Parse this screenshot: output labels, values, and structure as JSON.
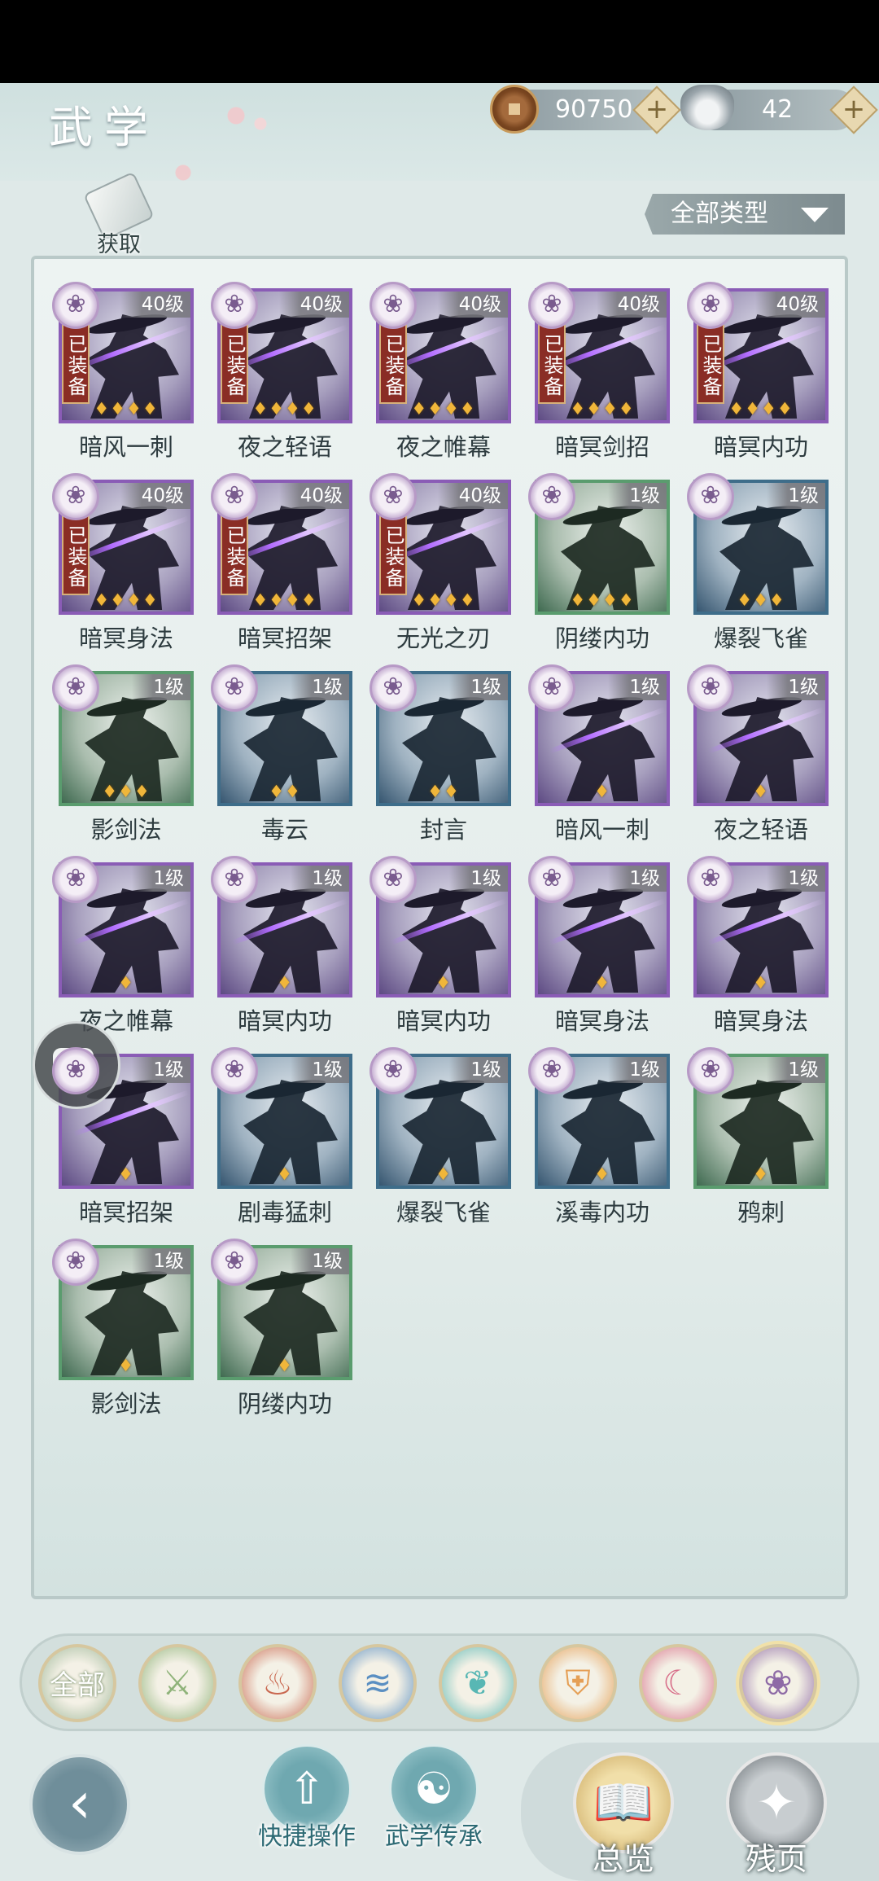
{
  "header": {
    "title": "武学",
    "copper": {
      "value": "90750",
      "icon": "copper-coin-icon"
    },
    "silver": {
      "value": "42",
      "icon": "silver-ingot-icon"
    },
    "plus": "+"
  },
  "acquire_label": "获取",
  "filter": {
    "label": "全部类型"
  },
  "equipped_label": "已装备",
  "skills": [
    {
      "name": "暗风一刺",
      "level": "40级",
      "equipped": true,
      "stars": 4,
      "quality": "purple"
    },
    {
      "name": "夜之轻语",
      "level": "40级",
      "equipped": true,
      "stars": 4,
      "quality": "purple"
    },
    {
      "name": "夜之帷幕",
      "level": "40级",
      "equipped": true,
      "stars": 4,
      "quality": "purple"
    },
    {
      "name": "暗冥剑招",
      "level": "40级",
      "equipped": true,
      "stars": 4,
      "quality": "purple"
    },
    {
      "name": "暗冥内功",
      "level": "40级",
      "equipped": true,
      "stars": 4,
      "quality": "purple"
    },
    {
      "name": "暗冥身法",
      "level": "40级",
      "equipped": true,
      "stars": 4,
      "quality": "purple"
    },
    {
      "name": "暗冥招架",
      "level": "40级",
      "equipped": true,
      "stars": 4,
      "quality": "purple"
    },
    {
      "name": "无光之刃",
      "level": "40级",
      "equipped": true,
      "stars": 4,
      "quality": "purple"
    },
    {
      "name": "阴缕内功",
      "level": "1级",
      "equipped": false,
      "stars": 4,
      "quality": "green"
    },
    {
      "name": "爆裂飞雀",
      "level": "1级",
      "equipped": false,
      "stars": 3,
      "quality": "blue"
    },
    {
      "name": "影剑法",
      "level": "1级",
      "equipped": false,
      "stars": 3,
      "quality": "green"
    },
    {
      "name": "毒云",
      "level": "1级",
      "equipped": false,
      "stars": 2,
      "quality": "blue"
    },
    {
      "name": "封言",
      "level": "1级",
      "equipped": false,
      "stars": 2,
      "quality": "blue"
    },
    {
      "name": "暗风一刺",
      "level": "1级",
      "equipped": false,
      "stars": 1,
      "quality": "purple"
    },
    {
      "name": "夜之轻语",
      "level": "1级",
      "equipped": false,
      "stars": 1,
      "quality": "purple"
    },
    {
      "name": "夜之帷幕",
      "level": "1级",
      "equipped": false,
      "stars": 1,
      "quality": "purple"
    },
    {
      "name": "暗冥内功",
      "level": "1级",
      "equipped": false,
      "stars": 1,
      "quality": "purple"
    },
    {
      "name": "暗冥内功",
      "level": "1级",
      "equipped": false,
      "stars": 1,
      "quality": "purple"
    },
    {
      "name": "暗冥身法",
      "level": "1级",
      "equipped": false,
      "stars": 1,
      "quality": "purple"
    },
    {
      "name": "暗冥身法",
      "level": "1级",
      "equipped": false,
      "stars": 1,
      "quality": "purple"
    },
    {
      "name": "暗冥招架",
      "level": "1级",
      "equipped": false,
      "stars": 1,
      "quality": "purple"
    },
    {
      "name": "剧毒猛刺",
      "level": "1级",
      "equipped": false,
      "stars": 1,
      "quality": "blue"
    },
    {
      "name": "爆裂飞雀",
      "level": "1级",
      "equipped": false,
      "stars": 1,
      "quality": "blue"
    },
    {
      "name": "溪毒内功",
      "level": "1级",
      "equipped": false,
      "stars": 1,
      "quality": "blue"
    },
    {
      "name": "鸦刺",
      "level": "1级",
      "equipped": false,
      "stars": 1,
      "quality": "green"
    },
    {
      "name": "影剑法",
      "level": "1级",
      "equipped": false,
      "stars": 1,
      "quality": "green"
    },
    {
      "name": "阴缕内功",
      "level": "1级",
      "equipped": false,
      "stars": 1,
      "quality": "green"
    }
  ],
  "school_tabs": [
    {
      "id": "all",
      "label": "全部",
      "icon": "all-schools-icon",
      "color": "#9fb89a",
      "selected": false
    },
    {
      "id": "sword",
      "label": "",
      "icon": "sword-school-icon",
      "color": "#8fb37a",
      "selected": false
    },
    {
      "id": "fire",
      "label": "",
      "icon": "flame-school-icon",
      "color": "#c9674f",
      "selected": false
    },
    {
      "id": "wave",
      "label": "",
      "icon": "wave-school-icon",
      "color": "#5a8fc2",
      "selected": false
    },
    {
      "id": "butterfly",
      "label": "",
      "icon": "butterfly-school-icon",
      "color": "#58b7b4",
      "selected": false
    },
    {
      "id": "shield",
      "label": "",
      "icon": "shield-school-icon",
      "color": "#e59f55",
      "selected": false
    },
    {
      "id": "moon",
      "label": "",
      "icon": "moon-school-icon",
      "color": "#d86f8a",
      "selected": false
    },
    {
      "id": "rose",
      "label": "",
      "icon": "rose-school-icon",
      "color": "#8e6aa6",
      "selected": true
    }
  ],
  "bottom_nav": {
    "quick_ops": "快捷操作",
    "inheritance": "武学传承",
    "overview": "总览",
    "fragments": "残页"
  }
}
